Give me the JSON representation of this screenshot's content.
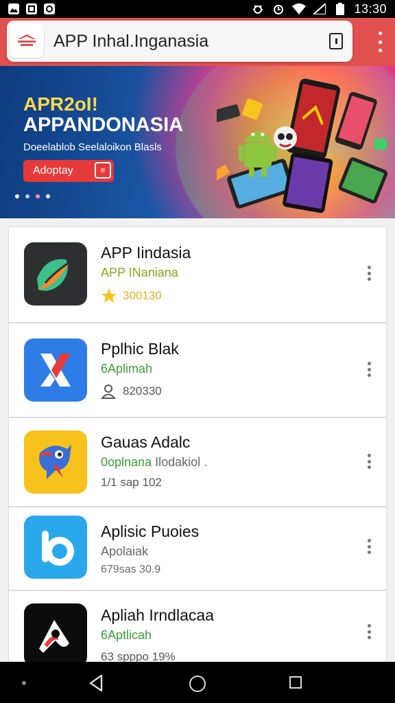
{
  "status_bar": {
    "time": "13:30",
    "left_icons": [
      "image-notification-icon",
      "crop-notification-icon",
      "sync-notification-icon"
    ],
    "right_icons": [
      "bug-icon",
      "alarm-icon",
      "wifi-icon",
      "no-signal-icon",
      "battery-icon"
    ]
  },
  "app_bar": {
    "title": "APP Inhal.Inganasia",
    "accent_color": "#e0514f"
  },
  "banner": {
    "kicker": "APR2oI!",
    "headline": "APPANDONASIA",
    "subtitle": "Doeelablob Seelaloikon Blasls",
    "cta_label": "Adoptay",
    "page_count": 4,
    "active_page": 0
  },
  "apps": [
    {
      "name": "APP Iindasia",
      "developer": "APP INaniana",
      "developer_color": "#8aa61c",
      "meta": "300130",
      "meta_icon": "star-icon",
      "meta_color": "#e0b21c",
      "icon_name": "leaf-app-icon"
    },
    {
      "name": "Pplhic Blak",
      "developer": "6Aplimah",
      "developer_color": "#3a9d3a",
      "meta": "820330",
      "meta_icon": "user-icon",
      "meta_color": "#555555",
      "icon_name": "x-app-icon"
    },
    {
      "name": "Gauas Adalc",
      "developer": "0oplnana",
      "developer_extra": "Ilodakiol .",
      "developer_color": "#3a9d3a",
      "meta": "1/1 sap 102",
      "meta_icon": "",
      "meta_color": "#555555",
      "icon_name": "bird-app-icon"
    },
    {
      "name": "Aplisic Puoies",
      "developer": "Apolaiak",
      "developer_color": "#666666",
      "meta": "679sas 30.9",
      "meta_icon": "",
      "meta_color": "#555555",
      "icon_name": "b-app-icon"
    },
    {
      "name": "Apliah Irndlacaa",
      "developer": "6Aptlicah",
      "developer_color": "#3a9d3a",
      "meta": "63 spppo 19%",
      "meta_icon": "",
      "meta_color": "#555555",
      "icon_name": "a-app-icon"
    }
  ]
}
